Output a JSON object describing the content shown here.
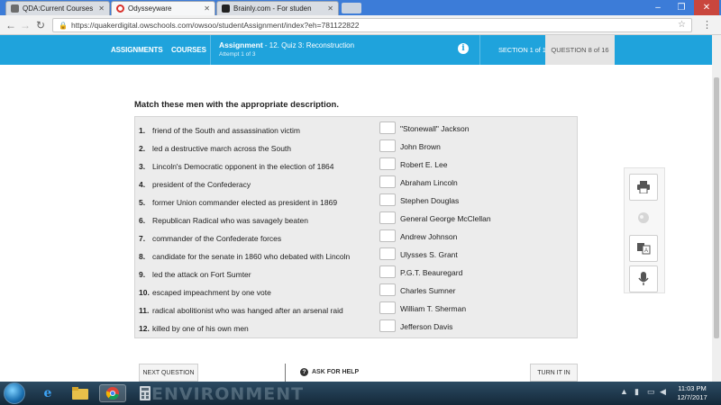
{
  "browser": {
    "tabs": [
      {
        "title": "QDA:Current Courses",
        "favicon_color": "#6d6d6d"
      },
      {
        "title": "Odysseyware",
        "favicon_color": "#d9312b"
      },
      {
        "title": "Brainly.com - For studen",
        "favicon_color": "#222222"
      }
    ],
    "url": "https://quakerdigital.owschools.com/owsoo/studentAssignment/index?eh=781122822"
  },
  "header": {
    "nav_assignments": "ASSIGNMENTS",
    "nav_courses": "COURSES",
    "assignment_label": "Assignment",
    "assignment_name": "- 12. Quiz 3: Reconstruction",
    "attempt": "Attempt 1 of 3",
    "section": "SECTION 1 of 1",
    "question": "QUESTION 8 of 16",
    "info_glyph": "i"
  },
  "quiz": {
    "instruction": "Match these men with the appropriate description.",
    "rows": [
      {
        "num": "1.",
        "desc": "friend of the South and assassination victim",
        "name": "\"Stonewall\" Jackson"
      },
      {
        "num": "2.",
        "desc": "led a destructive march across the South",
        "name": "John Brown"
      },
      {
        "num": "3.",
        "desc": "Lincoln's Democratic opponent in the election of 1864",
        "name": "Robert E. Lee"
      },
      {
        "num": "4.",
        "desc": "president of the Confederacy",
        "name": "Abraham Lincoln"
      },
      {
        "num": "5.",
        "desc": "former Union commander elected as president in 1869",
        "name": "Stephen Douglas"
      },
      {
        "num": "6.",
        "desc": "Republican Radical who was savagely beaten",
        "name": "General George McClellan"
      },
      {
        "num": "7.",
        "desc": "commander of the Confederate forces",
        "name": "Andrew Johnson"
      },
      {
        "num": "8.",
        "desc": "candidate for the senate in 1860 who debated with Lincoln",
        "name": "Ulysses S. Grant"
      },
      {
        "num": "9.",
        "desc": "led the attack on Fort Sumter",
        "name": "P.G.T. Beauregard"
      },
      {
        "num": "10.",
        "desc": "escaped impeachment by one vote",
        "name": "Charles Sumner"
      },
      {
        "num": "11.",
        "desc": "radical abolitionist who was hanged after an arsenal raid",
        "name": "William T. Sherman"
      },
      {
        "num": "12.",
        "desc": "killed by one of his own men",
        "name": "Jefferson Davis"
      }
    ]
  },
  "side_tools": {
    "icons": [
      "printer-icon",
      "globe-icon",
      "translate-icon",
      "microphone-icon"
    ]
  },
  "actions": {
    "next_question": "NEXT QUESTION",
    "ask_for_help": "ASK FOR HELP",
    "help_glyph": "?",
    "turn_it_in": "TURN IT IN"
  },
  "taskbar": {
    "wallpaper_text": "ENVIRONMENT",
    "time": "11:03 PM",
    "date": "12/7/2017"
  }
}
